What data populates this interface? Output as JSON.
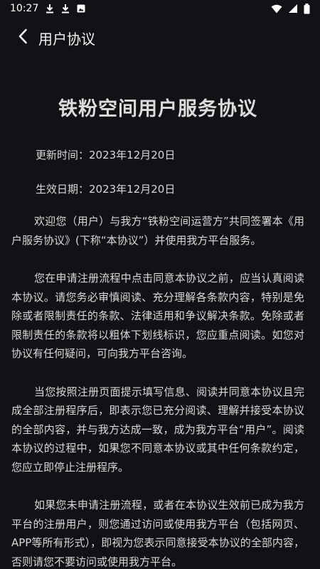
{
  "status_bar": {
    "time": "10:27",
    "left_icons": [
      "download-icon",
      "download-icon",
      "image-notification-icon"
    ],
    "right_icons": [
      "wifi-icon",
      "signal-icon",
      "battery-icon"
    ]
  },
  "header": {
    "back_icon": "chevron-left-icon",
    "title": "用户协议"
  },
  "document": {
    "title": "铁粉空间用户服务协议",
    "updated": "更新时间：2023年12月20日",
    "effective": "生效日期：2023年12月20日",
    "paragraphs": [
      "欢迎您（用户）与我方“铁粉空间运营方”共同签署本《用户服务协议》(下称“本协议”）并使用我方平台服务。",
      "您在申请注册流程中点击同意本协议之前，应当认真阅读本协议。请您务必审慎阅读、充分理解各条款内容，特别是免除或者限制责任的条款、法律适用和争议解决条款。免除或者限制责任的条款将以粗体下划线标识，您应重点阅读。如您对协议有任何疑问，可向我方平台咨询。",
      "当您按照注册页面提示填写信息、阅读并同意本协议且完成全部注册程序后，即表示您已充分阅读、理解并接受本协议的全部内容，并与我方达成一致，成为我方平台“用户”。阅读本协议的过程中，如果您不同意本协议或其中任何条款约定，您应立即停止注册程序。",
      "如果您未申请注册流程，或者在本协议生效前已成为我方平台的注册用户，则您通过访问或使用我方平台（包括网页、APP等所有形式），即视为您表示同意接受本协议的全部内容，否则请您不要访问或使用我方平台。"
    ]
  }
}
